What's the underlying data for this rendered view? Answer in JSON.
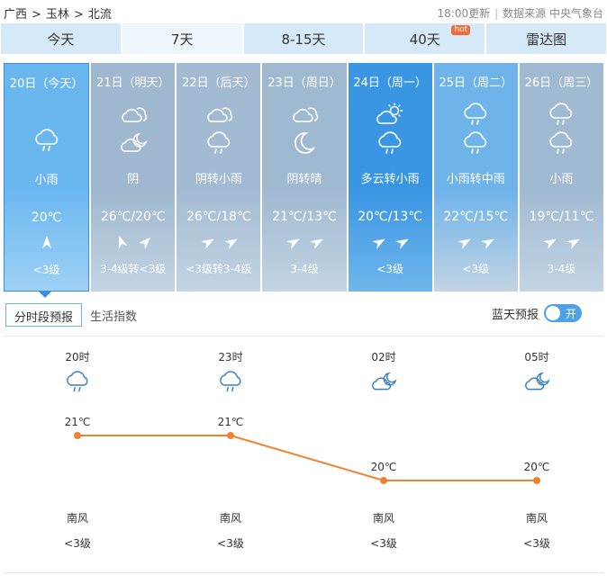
{
  "breadcrumb": {
    "region": "广西",
    "city": "玉林",
    "county": "北流",
    "separator": ">"
  },
  "source": {
    "updated": "18:00更新",
    "label": "数据来源",
    "provider": "中央气象台"
  },
  "tabs": [
    {
      "label": "今天",
      "active": false
    },
    {
      "label": "7天",
      "active": true
    },
    {
      "label": "8-15天",
      "active": false
    },
    {
      "label": "40天",
      "active": false,
      "badge": "hot"
    },
    {
      "label": "雷达图",
      "active": false
    }
  ],
  "days": [
    {
      "date": "20日（今天）",
      "icon_day": "rain-cloud-icon",
      "icon_night": "rain-cloud-icon",
      "desc": "小雨",
      "temp": "20℃",
      "wind_icons": [
        "wind-arrow-icon"
      ],
      "level": "<3级",
      "bg": "#6ab7f0",
      "today": true
    },
    {
      "date": "21日（明天）",
      "icon_day": "overcast-cloud-icon",
      "icon_night": "cloudy-night-icon",
      "desc": "阴",
      "temp": "26℃/20℃",
      "wind_icons": [
        "wind-arrow-icon",
        "wind-arrow-icon"
      ],
      "level": "3-4级转<3级",
      "bg": "#9fb8cf"
    },
    {
      "date": "22日（后天）",
      "icon_day": "overcast-cloud-icon",
      "icon_night": "rain-cloud-icon",
      "desc": "阴转小雨",
      "temp": "26℃/18℃",
      "wind_icons": [
        "wind-arrow-icon",
        "wind-arrow-icon"
      ],
      "level": "<3级转3-4级",
      "bg": "#a3bbd2"
    },
    {
      "date": "23日（周日）",
      "icon_day": "overcast-cloud-icon",
      "icon_night": "crescent-moon-icon",
      "desc": "阴转晴",
      "temp": "21℃/13℃",
      "wind_icons": [
        "wind-arrow-icon",
        "wind-arrow-icon"
      ],
      "level": "3-4级",
      "bg": "#9fb9d1"
    },
    {
      "date": "24日（周一）",
      "icon_day": "partly-cloudy-sun-icon",
      "icon_night": "rain-cloud-icon",
      "desc": "多云转小雨",
      "temp": "20℃/13℃",
      "wind_icons": [
        "wind-arrow-icon",
        "wind-arrow-icon"
      ],
      "level": "<3级",
      "bg": "#3a95e3"
    },
    {
      "date": "25日（周二）",
      "icon_day": "rain-cloud-icon",
      "icon_night": "rain-cloud-icon",
      "desc": "小雨转中雨",
      "temp": "22℃/15℃",
      "wind_icons": [
        "wind-arrow-icon",
        "wind-arrow-icon"
      ],
      "level": "<3级",
      "bg": "#6eb3ea"
    },
    {
      "date": "26日（周三）",
      "icon_day": "rain-cloud-icon",
      "icon_night": "rain-cloud-icon",
      "desc": "小雨",
      "temp": "19℃/11℃",
      "wind_icons": [
        "wind-arrow-icon",
        "wind-arrow-icon"
      ],
      "level": "3-4级",
      "bg": "#a0bad2"
    }
  ],
  "subtabs": [
    {
      "label": "分时段预报",
      "active": true
    },
    {
      "label": "生活指数",
      "active": false
    }
  ],
  "bluesky": {
    "label": "蓝天预报",
    "toggle": "开"
  },
  "hourly": [
    {
      "time": "20时",
      "icon": "rain-cloud-icon",
      "temp": "21℃",
      "temp_value": 21,
      "wind": "南风",
      "level": "<3级"
    },
    {
      "time": "23时",
      "icon": "rain-cloud-icon",
      "temp": "21℃",
      "temp_value": 21,
      "wind": "南风",
      "level": "<3级"
    },
    {
      "time": "02时",
      "icon": "cloudy-night-icon",
      "temp": "20℃",
      "temp_value": 20,
      "wind": "南风",
      "level": "<3级"
    },
    {
      "time": "05时",
      "icon": "cloudy-night-icon",
      "temp": "20℃",
      "temp_value": 20,
      "wind": "南风",
      "level": "<3级"
    }
  ],
  "colors": {
    "line": "#f0822f",
    "tab_bg": "#d6e9f8",
    "accent": "#3a8ee0"
  }
}
